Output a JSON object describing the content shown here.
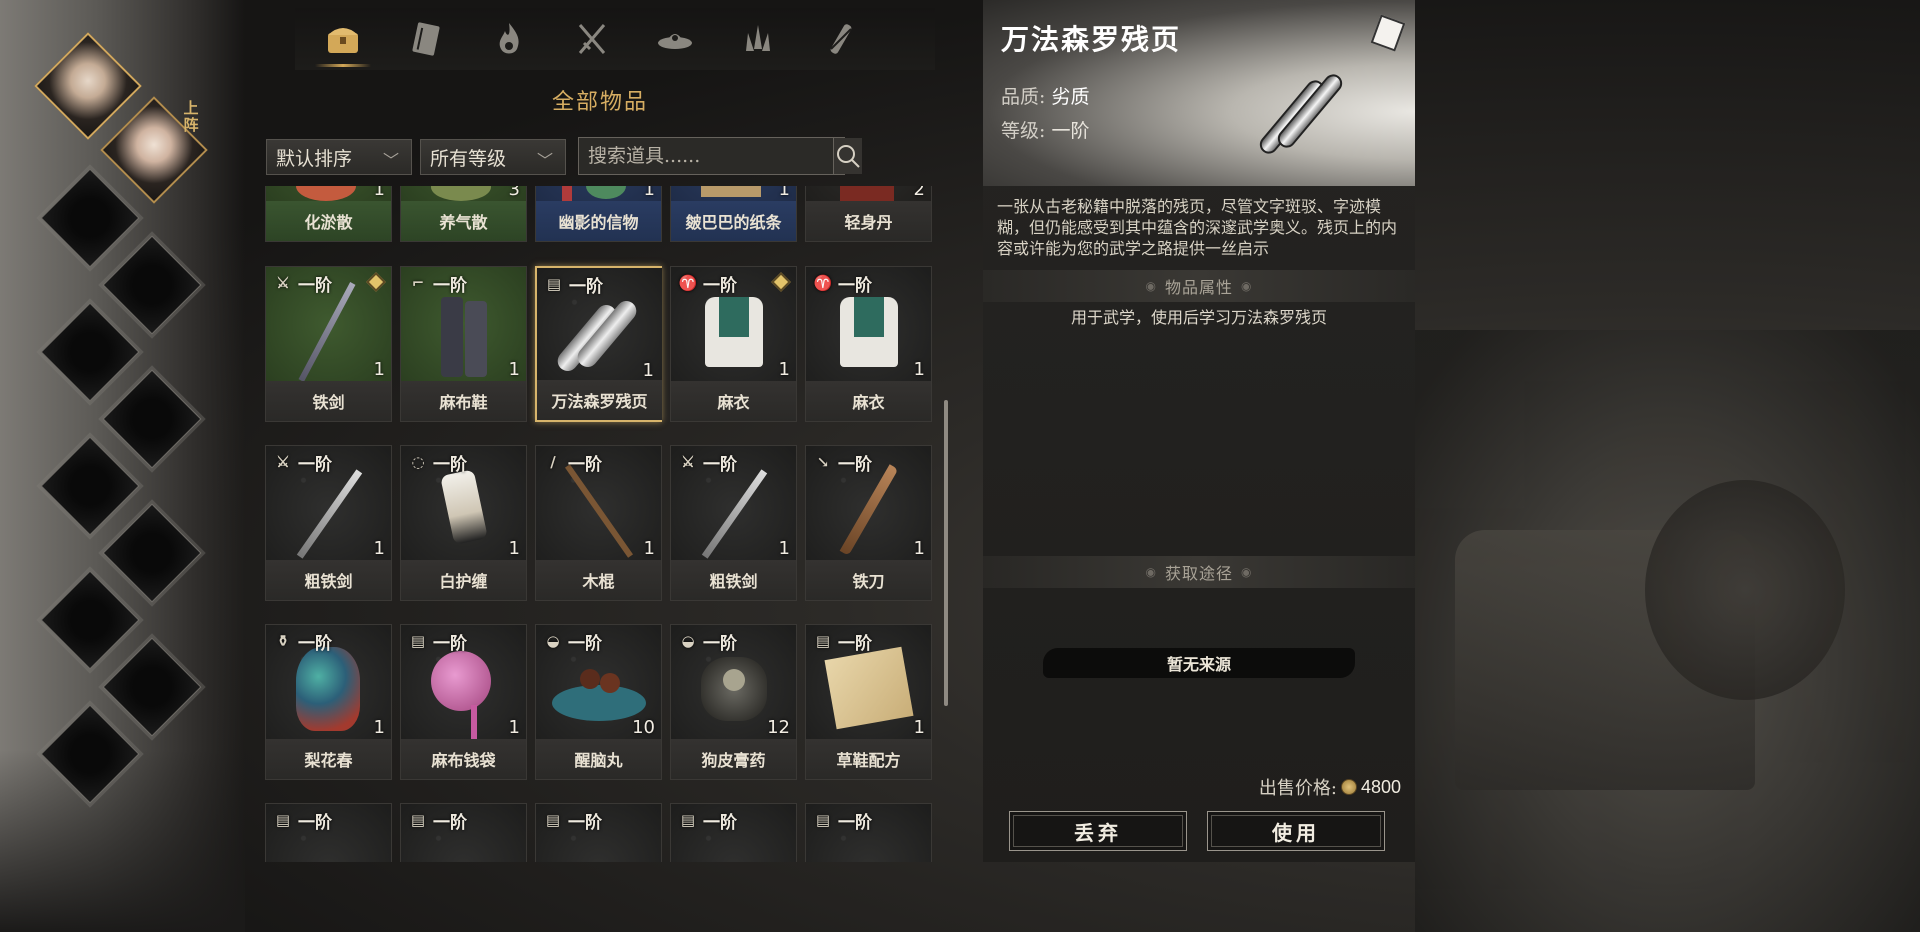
{
  "tabs": [
    {
      "icon": "chest-icon",
      "active": true
    },
    {
      "icon": "book-icon",
      "active": false
    },
    {
      "icon": "flame-icon",
      "active": false
    },
    {
      "icon": "crossed-swords-icon",
      "active": false
    },
    {
      "icon": "hat-icon",
      "active": false
    },
    {
      "icon": "herb-icon",
      "active": false
    },
    {
      "icon": "scroll-weapon-icon",
      "active": false
    }
  ],
  "section_title": "全部物品",
  "characters": {
    "onstage_label": "上阵"
  },
  "filters": {
    "sort": "默认排序",
    "grade": "所有等级",
    "search_placeholder": "搜索道具......"
  },
  "grid": {
    "row0": [
      {
        "name": "化淤散",
        "count": "1",
        "color": "green"
      },
      {
        "name": "养气散",
        "count": "3",
        "color": "green"
      },
      {
        "name": "幽影的信物",
        "count": "1",
        "color": "blue"
      },
      {
        "name": "皴巴巴的纸条",
        "count": "1",
        "color": "blue"
      },
      {
        "name": "轻身丹",
        "count": "2",
        "color": "plain"
      }
    ],
    "row1": [
      {
        "name": "铁剑",
        "count": "1",
        "tier": "一阶",
        "tag": "sword-icon",
        "gem": true,
        "art": "green"
      },
      {
        "name": "麻布鞋",
        "count": "1",
        "tier": "一阶",
        "tag": "boot-icon",
        "gem": false,
        "art": "green"
      },
      {
        "name": "万法森罗残页",
        "count": "1",
        "tier": "一阶",
        "tag": "scroll-icon",
        "gem": false,
        "art": "stone"
      },
      {
        "name": "麻衣",
        "count": "1",
        "tier": "一阶",
        "tag": "armor-icon",
        "gem": true,
        "art": "stone"
      },
      {
        "name": "麻衣",
        "count": "1",
        "tier": "一阶",
        "tag": "armor-icon",
        "gem": false,
        "art": "stone"
      }
    ],
    "row2": [
      {
        "name": "粗铁剑",
        "count": "1",
        "tier": "一阶",
        "tag": "sword-icon"
      },
      {
        "name": "白护缠",
        "count": "1",
        "tier": "一阶",
        "tag": "wrap-icon"
      },
      {
        "name": "木棍",
        "count": "1",
        "tier": "一阶",
        "tag": "staff-icon"
      },
      {
        "name": "粗铁剑",
        "count": "1",
        "tier": "一阶",
        "tag": "sword-icon"
      },
      {
        "name": "铁刀",
        "count": "1",
        "tier": "一阶",
        "tag": "blade-icon"
      }
    ],
    "row3": [
      {
        "name": "梨花春",
        "count": "1",
        "tier": "一阶",
        "tag": "wine-icon"
      },
      {
        "name": "麻布钱袋",
        "count": "1",
        "tier": "一阶",
        "tag": "scroll-icon"
      },
      {
        "name": "醒脑丸",
        "count": "10",
        "tier": "一阶",
        "tag": "bowl-icon"
      },
      {
        "name": "狗皮膏药",
        "count": "12",
        "tier": "一阶",
        "tag": "bowl-icon"
      },
      {
        "name": "草鞋配方",
        "count": "1",
        "tier": "一阶",
        "tag": "scroll-icon"
      }
    ],
    "row4": [
      {
        "tier": "一阶"
      },
      {
        "tier": "一阶"
      },
      {
        "tier": "一阶"
      },
      {
        "tier": "一阶"
      },
      {
        "tier": "一阶"
      }
    ]
  },
  "detail": {
    "title": "万法森罗残页",
    "quality_label": "品质:",
    "quality_value": "劣质",
    "grade_label": "等级:",
    "grade_value": "一阶",
    "description": "一张从古老秘籍中脱落的残页，尽管文字斑驳、字迹模糊，但仍能感受到其中蕴含的深邃武学奥义。残页上的内容或许能为您的武学之路提供一丝启示",
    "attr_header": "物品属性",
    "attr_text": "用于武学，使用后学习万法森罗残页",
    "source_header": "获取途径",
    "source_text": "暂无来源",
    "price_label": "出售价格:",
    "price_value": "4800",
    "discard_label": "丢弃",
    "use_label": "使用"
  }
}
